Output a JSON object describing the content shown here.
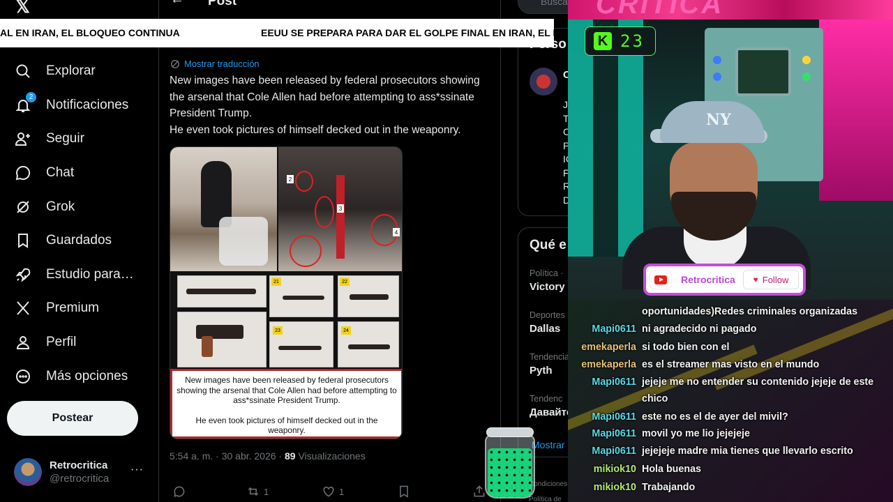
{
  "sidebar": {
    "logo_glyph": "𝕏",
    "nav": [
      {
        "label": "Explorar",
        "icon": "search-icon"
      },
      {
        "label": "Notificaciones",
        "icon": "bell-icon",
        "badge": "2"
      },
      {
        "label": "Seguir",
        "icon": "follow-icon"
      },
      {
        "label": "Chat",
        "icon": "chat-icon"
      },
      {
        "label": "Grok",
        "icon": "grok-icon"
      },
      {
        "label": "Guardados",
        "icon": "bookmark-icon"
      },
      {
        "label": "Estudio para creadores",
        "icon": "rocket-icon"
      },
      {
        "label": "Premium",
        "icon": "x-logo-icon"
      },
      {
        "label": "Perfil",
        "icon": "person-icon"
      },
      {
        "label": "Más opciones",
        "icon": "more-circle-icon"
      }
    ],
    "post_button": "Postear",
    "account": {
      "name": "Retrocritica",
      "handle": "@retrocritica",
      "more": "···"
    }
  },
  "header": {
    "back": "←",
    "title": "Post"
  },
  "ticker": {
    "items": [
      "AL EN IRAN, EL BLOQUEO CONTINUA",
      "EEUU SE PREPARA PARA DAR EL GOLPE FINAL EN IRAN, EL BLOQUEO CONTINUA"
    ]
  },
  "tweet": {
    "translate_label": "Mostrar traducción",
    "lines": [
      "New images have been released by federal prosecutors showing the arsenal that Cole Allen had before attempting to ass*ssinate President Trump.",
      "He even took pictures of himself decked out in the weaponry."
    ],
    "media": {
      "markers": [
        "2",
        "3",
        "4"
      ],
      "evidence_tags": [
        "21",
        "22",
        "23",
        "24"
      ],
      "caption_1": "New images have been released by federal prosecutors showing the arsenal that Cole Allen had before attempting to ass*ssinate President Trump.",
      "caption_2": "He even took pictures of himself decked out in the weaponry."
    },
    "timestamp": "5:54 a. m. · 30 abr. 2026 · ",
    "views_count": "89",
    "views_label": " Visualizaciones",
    "actions": {
      "reply_count": "",
      "repost_count": "1",
      "like_count": "1"
    }
  },
  "right": {
    "search_placeholder": "Busca",
    "who_title": "Perso",
    "who_name": "C",
    "who_letters": [
      "Jl",
      "T",
      "C",
      "P",
      "IC",
      "F",
      "R",
      "D"
    ],
    "trend_title": "Qué e",
    "trends": [
      {
        "cat": "Política ·",
        "name": "Victory"
      },
      {
        "cat": "Deportes",
        "name": "Dallas"
      },
      {
        "cat": "Tendencia",
        "name": "Pyth"
      },
      {
        "cat": "Tendenc",
        "name": "Давайте"
      }
    ],
    "show_more": "Mostrar",
    "footer": [
      "Condiciones",
      "Política de"
    ]
  },
  "stream": {
    "banner_text": "CRITICA",
    "kick_count": "23",
    "cap_logo": "NY",
    "card": {
      "name": "Retrocritica",
      "follow": "Follow"
    },
    "chat": [
      {
        "user": "",
        "msg": "oportunidades)Redes criminales organizadas",
        "color": "#ffffff"
      },
      {
        "user": "Mapi0611",
        "msg": "ni agradecido ni pagado",
        "color": "#5ad8e6"
      },
      {
        "user": "emekaperla",
        "msg": "si todo bien con el",
        "color": "#e8c17a"
      },
      {
        "user": "emekaperla",
        "msg": "es el streamer mas visto en el mundo",
        "color": "#e8c17a"
      },
      {
        "user": "Mapi0611",
        "msg": "jejeje me no entender su contenido jejeje de este chico",
        "color": "#5ad8e6"
      },
      {
        "user": "Mapi0611",
        "msg": "este no es el de ayer del mivil?",
        "color": "#5ad8e6"
      },
      {
        "user": "Mapi0611",
        "msg": "movil yo me lio jejejeje",
        "color": "#5ad8e6"
      },
      {
        "user": "Mapi0611",
        "msg": "jejejeje madre mia tienes que llevarlo escrito",
        "color": "#5ad8e6"
      },
      {
        "user": "mikiok10",
        "msg": "Hola buenas",
        "color": "#b6e873"
      },
      {
        "user": "mikiok10",
        "msg": "Trabajando",
        "color": "#b6e873"
      }
    ]
  }
}
